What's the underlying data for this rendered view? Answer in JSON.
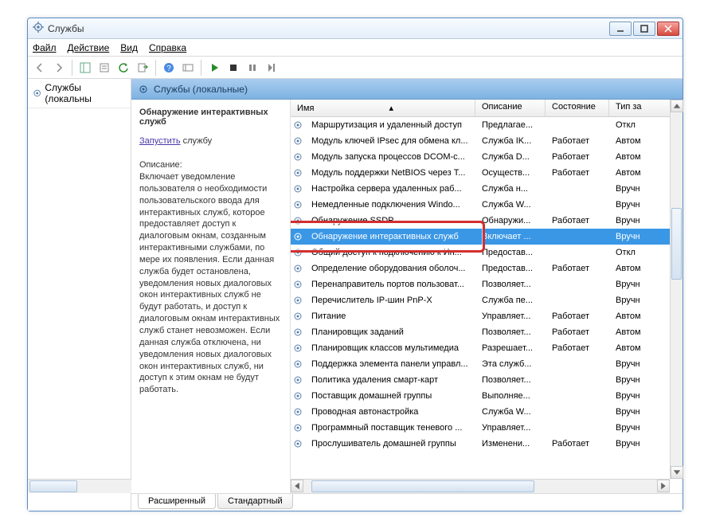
{
  "window_title": "Службы",
  "menu": {
    "file": "Файл",
    "action": "Действие",
    "view": "Вид",
    "help": "Справка"
  },
  "nav": {
    "item": "Службы (локальны"
  },
  "header": "Службы (локальные)",
  "detail": {
    "title": "Обнаружение интерактивных служб",
    "start_link": "Запустить",
    "start_suffix": " службу",
    "desc_label": "Описание:",
    "desc": "Включает уведомление пользователя о необходимости пользовательского ввода для интерактивных служб, которое предоставляет доступ к диалоговым окнам, созданным интерактивными службами, по мере их появления. Если данная служба будет остановлена, уведомления новых диалоговых окон интерактивных служб не будут работать, и доступ к диалоговым окнам интерактивных служб станет невозможен. Если данная служба отключена, ни уведомления новых диалоговых окон интерактивных служб, ни доступ к этим окнам не будут работать."
  },
  "columns": {
    "name": "Имя",
    "desc": "Описание",
    "state": "Состояние",
    "type": "Тип за"
  },
  "rows": [
    {
      "name": "Маршрутизация и удаленный доступ",
      "desc": "Предлагае...",
      "state": "",
      "type": "Откл"
    },
    {
      "name": "Модуль ключей IPsec для обмена кл...",
      "desc": "Служба IK...",
      "state": "Работает",
      "type": "Автом"
    },
    {
      "name": "Модуль запуска процессов DCOM-с...",
      "desc": "Служба D...",
      "state": "Работает",
      "type": "Автом"
    },
    {
      "name": "Модуль поддержки NetBIOS через T...",
      "desc": "Осуществ...",
      "state": "Работает",
      "type": "Автом"
    },
    {
      "name": "Настройка сервера удаленных раб...",
      "desc": "Служба н...",
      "state": "",
      "type": "Вручн"
    },
    {
      "name": "Немедленные подключения Windo...",
      "desc": "Служба W...",
      "state": "",
      "type": "Вручн"
    },
    {
      "name": "Обнаружение SSDP",
      "desc": "Обнаружи...",
      "state": "Работает",
      "type": "Вручн"
    },
    {
      "name": "Обнаружение интерактивных служб",
      "desc": "Включает ...",
      "state": "",
      "type": "Вручн",
      "selected": true
    },
    {
      "name": "Общий доступ к подключению к Ин...",
      "desc": "Предостав...",
      "state": "",
      "type": "Откл"
    },
    {
      "name": "Определение оборудования оболоч...",
      "desc": "Предостав...",
      "state": "Работает",
      "type": "Автом"
    },
    {
      "name": "Перенаправитель портов пользоват...",
      "desc": "Позволяет...",
      "state": "",
      "type": "Вручн"
    },
    {
      "name": "Перечислитель IP-шин PnP-X",
      "desc": "Служба пе...",
      "state": "",
      "type": "Вручн"
    },
    {
      "name": "Питание",
      "desc": "Управляет...",
      "state": "Работает",
      "type": "Автом"
    },
    {
      "name": "Планировщик заданий",
      "desc": "Позволяет...",
      "state": "Работает",
      "type": "Автом"
    },
    {
      "name": "Планировщик классов мультимедиа",
      "desc": "Разрешает...",
      "state": "Работает",
      "type": "Автом"
    },
    {
      "name": "Поддержка элемента панели управл...",
      "desc": "Эта служб...",
      "state": "",
      "type": "Вручн"
    },
    {
      "name": "Политика удаления смарт-карт",
      "desc": "Позволяет...",
      "state": "",
      "type": "Вручн"
    },
    {
      "name": "Поставщик домашней группы",
      "desc": "Выполняе...",
      "state": "",
      "type": "Вручн"
    },
    {
      "name": "Проводная автонастройка",
      "desc": "Служба W...",
      "state": "",
      "type": "Вручн"
    },
    {
      "name": "Программный поставщик теневого ...",
      "desc": "Управляет...",
      "state": "",
      "type": "Вручн"
    },
    {
      "name": "Прослушиватель домашней группы",
      "desc": "Изменени...",
      "state": "Работает",
      "type": "Вручн"
    }
  ],
  "tabs": {
    "extended": "Расширенный",
    "standard": "Стандартный"
  }
}
